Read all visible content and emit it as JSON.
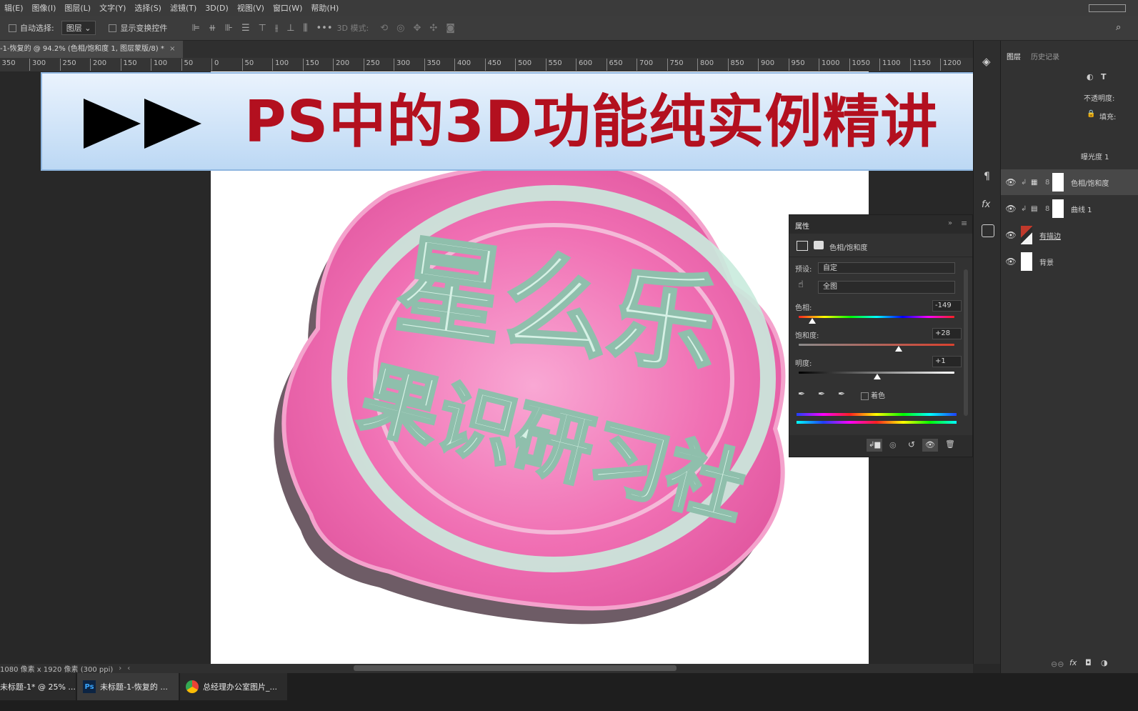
{
  "menu": [
    "辑(E)",
    "图像(I)",
    "图层(L)",
    "文字(Y)",
    "选择(S)",
    "滤镜(T)",
    "3D(D)",
    "视图(V)",
    "窗口(W)",
    "帮助(H)"
  ],
  "options": {
    "auto_select": "自动选择:",
    "auto_select_value": "图层",
    "show_transform": "显示变换控件",
    "mode_3d": "3D 模式:"
  },
  "doc_tab": "-1-恢复的 @ 94.2% (色相/饱和度 1, 图层蒙版/8) *",
  "ruler": [
    "350",
    "300",
    "250",
    "200",
    "150",
    "100",
    "50",
    "0",
    "50",
    "100",
    "150",
    "200",
    "250",
    "300",
    "350",
    "400",
    "450",
    "500",
    "550",
    "600",
    "650",
    "700",
    "750",
    "800",
    "850",
    "900",
    "950",
    "1000",
    "1050",
    "1100",
    "1150",
    "1200"
  ],
  "banner": {
    "title": "PS中的3D功能纯实例精讲"
  },
  "artwork": {
    "line1": "星么乐",
    "line2": "果识研习社"
  },
  "layers_panel": {
    "tab_layers": "图层",
    "tab_history": "历史记录",
    "opacity_label": "不透明度:",
    "fill_label": "填充:",
    "exposure": "曝光度 1",
    "layers": [
      {
        "name": "色相/饱和度"
      },
      {
        "name": "曲线 1"
      },
      {
        "name": "有描边"
      },
      {
        "name": "背景"
      }
    ]
  },
  "properties": {
    "title": "属性",
    "adjustment": "色相/饱和度",
    "preset_label": "预设:",
    "preset_value": "自定",
    "channel_value": "全图",
    "hue_label": "色相:",
    "hue_value": "-149",
    "hue": -149,
    "saturation_label": "饱和度:",
    "saturation_value": "+28",
    "saturation": 28,
    "lightness_label": "明度:",
    "lightness_value": "+1",
    "lightness": 1,
    "colorize_label": "着色"
  },
  "status": {
    "dims": "1080 像素 x 1920 像素 (300 ppi)"
  },
  "taskbar": [
    {
      "label": "未标题-1* @ 25% ..."
    },
    {
      "label": "未标题-1-恢复的 ..."
    },
    {
      "label": "总经理办公室图片_..."
    }
  ],
  "colors": {
    "title_red": "#b3101f",
    "pink": "#f06fb3",
    "mint": "#c9ebdd"
  }
}
